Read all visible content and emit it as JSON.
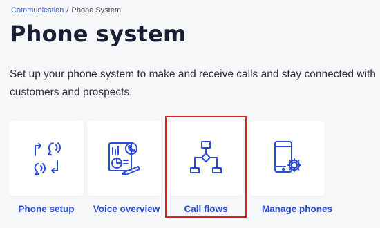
{
  "breadcrumb": {
    "parent": "Communication",
    "separator": "/",
    "current": "Phone System"
  },
  "header": {
    "title": "Phone system"
  },
  "description": "Set up your phone system to make and receive calls and stay connected with customers and prospects.",
  "colors": {
    "accent": "#2a4bd7",
    "highlight": "#e0201b",
    "background": "#f6f7f9",
    "card": "#ffffff"
  },
  "cards": [
    {
      "label": "Phone setup",
      "icon": "phone-setup-icon"
    },
    {
      "label": "Voice overview",
      "icon": "voice-overview-icon"
    },
    {
      "label": "Call flows",
      "icon": "call-flows-icon",
      "highlighted": true
    },
    {
      "label": "Manage phones",
      "icon": "manage-phones-icon"
    }
  ]
}
